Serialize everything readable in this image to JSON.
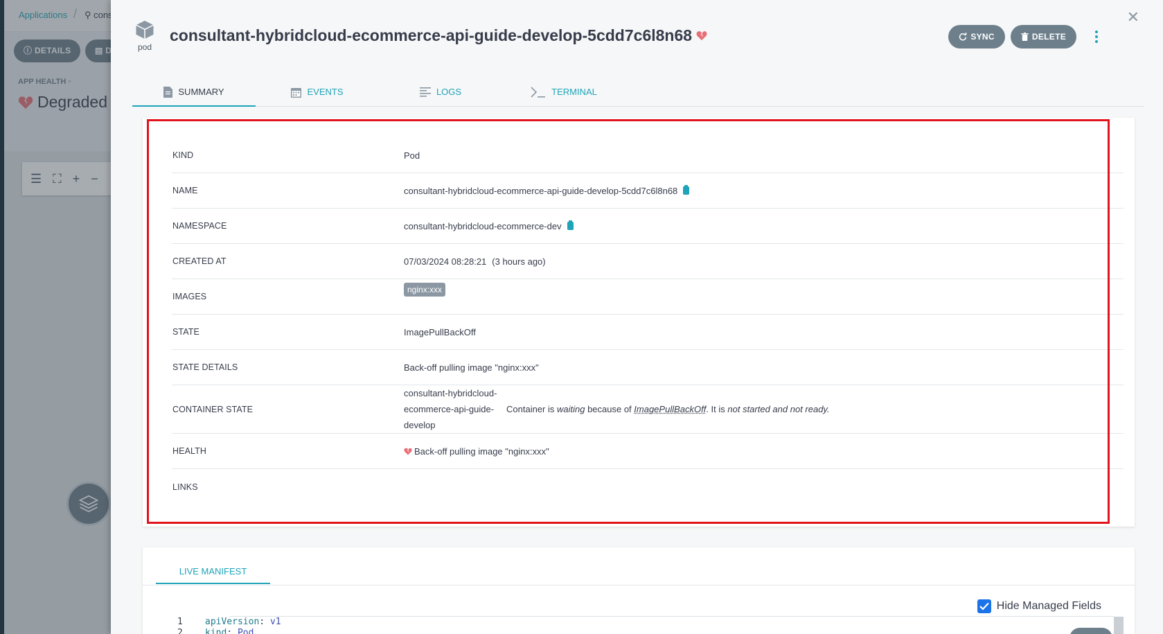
{
  "background": {
    "breadcrumb": {
      "app": "Applications",
      "current": "cons"
    },
    "details_button": "DETAILS",
    "second_button": "D",
    "app_health_label": "APP HEALTH",
    "app_health_value": "Degraded"
  },
  "panel": {
    "kind_label": "pod",
    "title": "consultant-hybridcloud-ecommerce-api-guide-develop-5cdd7c6l8n68",
    "actions": {
      "sync": "SYNC",
      "delete": "DELETE"
    },
    "tabs": [
      {
        "label": "SUMMARY",
        "icon": "file-icon",
        "active": true
      },
      {
        "label": "EVENTS",
        "icon": "calendar-icon",
        "active": false
      },
      {
        "label": "LOGS",
        "icon": "align-left-icon",
        "active": false
      },
      {
        "label": "TERMINAL",
        "icon": "terminal-icon",
        "active": false
      }
    ],
    "summary": {
      "kind": {
        "label": "KIND",
        "value": "Pod"
      },
      "name": {
        "label": "NAME",
        "value": "consultant-hybridcloud-ecommerce-api-guide-develop-5cdd7c6l8n68"
      },
      "namespace": {
        "label": "NAMESPACE",
        "value": "consultant-hybridcloud-ecommerce-dev"
      },
      "created_at": {
        "label": "CREATED AT",
        "value": "07/03/2024 08:28:21",
        "relative": "(3 hours ago)"
      },
      "images": {
        "label": "IMAGES",
        "value": "nginx:xxx"
      },
      "state": {
        "label": "STATE",
        "value": "ImagePullBackOff"
      },
      "state_details": {
        "label": "STATE DETAILS",
        "value": "Back-off pulling image \"nginx:xxx\""
      },
      "container_state": {
        "label": "CONTAINER STATE",
        "container_name_lines": [
          "consultant-hybridcloud-",
          "ecommerce-api-guide-",
          "develop"
        ],
        "msg_prefix": "Container is ",
        "msg_waiting": "waiting",
        "msg_because": " because of ",
        "msg_reason": "ImagePullBackOff",
        "msg_mid": ". It is ",
        "msg_tail": "not started and not ready."
      },
      "health": {
        "label": "HEALTH",
        "value": "Back-off pulling image \"nginx:xxx\""
      },
      "links": {
        "label": "LINKS"
      }
    },
    "manifest": {
      "tab": "LIVE MANIFEST",
      "hide_managed_fields": "Hide Managed Fields",
      "hide_managed_checked": true,
      "lines": [
        {
          "num": "1",
          "key": "apiVersion",
          "sep": ": ",
          "val": "v1"
        },
        {
          "num": "2",
          "key": "kind",
          "sep": ": ",
          "val": "Pod"
        }
      ]
    }
  },
  "colors": {
    "accent": "#1fa3b8",
    "degraded": "#e96d76",
    "highlight_box": "#e3131c",
    "button": "#6d7f8b"
  }
}
